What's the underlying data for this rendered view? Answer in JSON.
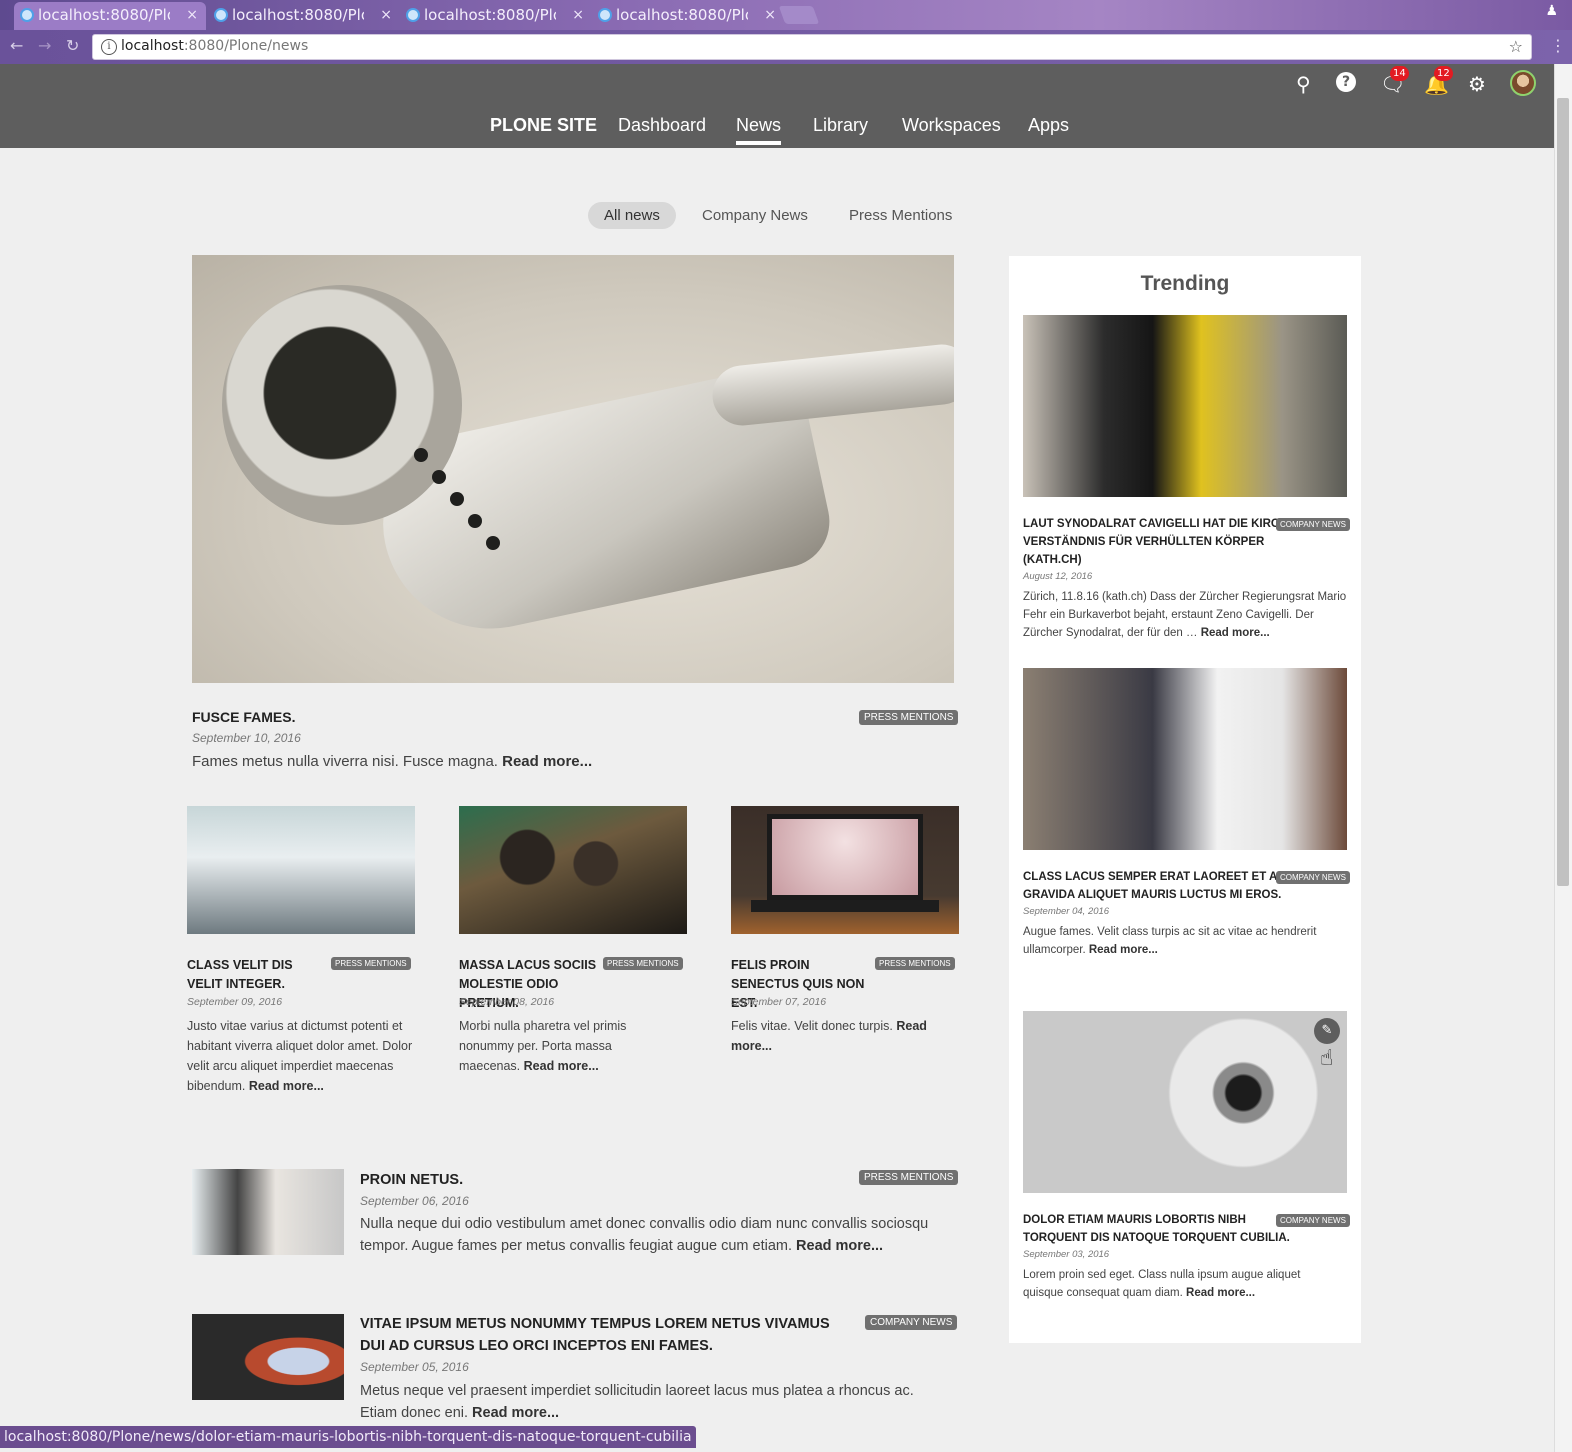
{
  "browser": {
    "tabs": [
      {
        "label": "localhost:8080/Plo",
        "close": "×"
      },
      {
        "label": "localhost:8080/Plo",
        "close": "×"
      },
      {
        "label": "localhost:8080/Plo",
        "close": "×"
      },
      {
        "label": "localhost:8080/Plo",
        "close": "×"
      }
    ],
    "url_host": "localhost",
    "url_rest": ":8080/Plone/news",
    "status_url": "localhost:8080/Plone/news/dolor-etiam-mauris-lobortis-nibh-torquent-dis-natoque-torquent-cubilia",
    "icons": {
      "back": "back-arrow-icon",
      "forward": "forward-arrow-icon",
      "reload": "reload-icon",
      "info": "info-icon",
      "star": "bookmark-star-icon"
    }
  },
  "header": {
    "site": "PLONE SITE",
    "nav": [
      "Dashboard",
      "News",
      "Library",
      "Workspaces",
      "Apps"
    ],
    "active_nav": "News",
    "messages_count": "14",
    "notifications_count": "12",
    "icons": [
      "search-icon",
      "help-icon",
      "messages-icon",
      "notifications-icon",
      "settings-icon",
      "avatar"
    ]
  },
  "filters": {
    "all": "All news",
    "company": "Company News",
    "press": "Press Mentions",
    "active": "All news"
  },
  "featured": {
    "title": "Fusce fames.",
    "tag": "Press Mentions",
    "date": "September 10, 2016",
    "desc": "Fames metus nulla viverra nisi. Fusce magna.",
    "more": "Read more..."
  },
  "grid": [
    {
      "title": "Class velit dis velit integer.",
      "tag": "Press Mentions",
      "date": "September 09, 2016",
      "desc": "Justo vitae varius at dictumst potenti et habitant viverra aliquet dolor amet. Dolor velit arcu aliquet imperdiet maecenas bibendum.",
      "more": "Read more..."
    },
    {
      "title": "Massa lacus sociis molestie odio pretium.",
      "tag": "Press Mentions",
      "date": "September 08, 2016",
      "desc": "Morbi nulla pharetra vel primis nonummy per. Porta massa maecenas.",
      "more": "Read more..."
    },
    {
      "title": "Felis proin senectus quis non est.",
      "tag": "Press Mentions",
      "date": "September 07, 2016",
      "desc": "Felis vitae. Velit donec turpis.",
      "more": "Read more..."
    }
  ],
  "list": [
    {
      "title": "Proin netus.",
      "tag": "Press Mentions",
      "date": "September 06, 2016",
      "desc": "Nulla neque dui odio vestibulum amet donec convallis odio diam nunc convallis sociosqu tempor. Augue fames per metus convallis feugiat augue cum etiam.",
      "more": "Read more..."
    },
    {
      "title": "Vitae ipsum metus nonummy tempus lorem netus vivamus dui ad cursus leo orci inceptos eni fames.",
      "tag": "Company News",
      "date": "September 05, 2016",
      "desc": "Metus neque vel praesent imperdiet sollicitudin laoreet lacus mus platea a rhoncus ac. Etiam donec eni.",
      "more": "Read more..."
    }
  ],
  "trending": {
    "heading": "Trending",
    "items": [
      {
        "title": "Laut Synodalrat Cavigelli hat die Kirche Verständnis für verhüllten Körper (kath.ch)",
        "tag": "Company News",
        "date": "August 12, 2016",
        "desc": "Zürich, 11.8.16 (kath.ch) Dass der Zürcher Regierungsrat Mario Fehr ein Burkaverbot bejaht, erstaunt Zeno Cavigelli. Der Zürcher Synodalrat, der für den …",
        "more": "Read more..."
      },
      {
        "title": "Class lacus semper erat laoreet et accumsan gravida aliquet mauris luctus mi eros.",
        "tag": "Company News",
        "date": "September 04, 2016",
        "desc": "Augue fames. Velit class turpis ac sit ac vitae ac hendrerit ullamcorper.",
        "more": "Read more..."
      },
      {
        "title": "Dolor etiam mauris lobortis nibh torquent dis natoque torquent cubilia.",
        "tag": "Company News",
        "date": "September 03, 2016",
        "desc": "Lorem proin sed eget. Class nulla ipsum augue aliquet quisque consequat quam diam.",
        "more": "Read more..."
      }
    ],
    "edit_icon": "edit-pencil-icon"
  },
  "colors": {
    "header_bg": "#5e5e5e",
    "page_bg": "#efefef",
    "tag_bg": "#707070",
    "badge": "#e21b22"
  }
}
